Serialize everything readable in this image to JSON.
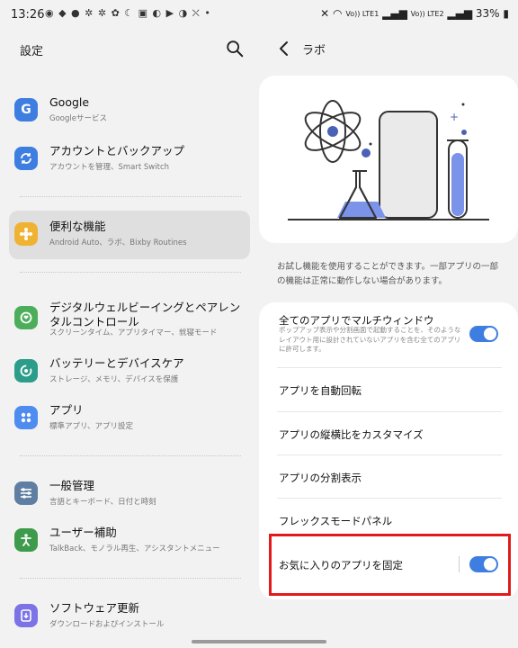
{
  "status_bar": {
    "time": "13:26",
    "notification_icons": "◉ ◆ ● ✲ ✲ ✿ ☾ ▣ ◐ ▶ ◑ ⛌ •",
    "network_label_1": "Vo)) LTE1",
    "network_label_2": "Vo)) LTE2",
    "battery": "33%"
  },
  "settings": {
    "title": "設定",
    "items": [
      {
        "title": "Google",
        "subtitle": "Googleサービス",
        "icon": "google-icon",
        "color": "#3d7ee0"
      },
      {
        "title": "アカウントとバックアップ",
        "subtitle": "アカウントを管理、Smart Switch",
        "icon": "sync-icon",
        "color": "#3d7ee0"
      },
      {
        "title": "便利な機能",
        "subtitle": "Android Auto、ラボ、Bixby Routines",
        "icon": "advanced-features-icon",
        "color": "#f0b233"
      },
      {
        "title": "デジタルウェルビーイングとペアレンタルコントロール",
        "subtitle": "スクリーンタイム、アプリタイマー、就寝モード",
        "icon": "wellbeing-icon",
        "color": "#4cae5a"
      },
      {
        "title": "バッテリーとデバイスケア",
        "subtitle": "ストレージ、メモリ、デバイスを保護",
        "icon": "device-care-icon",
        "color": "#2b9d8a"
      },
      {
        "title": "アプリ",
        "subtitle": "標準アプリ、アプリ設定",
        "icon": "apps-icon",
        "color": "#4e8cf0"
      },
      {
        "title": "一般管理",
        "subtitle": "言語とキーボード、日付と時刻",
        "icon": "general-management-icon",
        "color": "#5f7fa2"
      },
      {
        "title": "ユーザー補助",
        "subtitle": "TalkBack、モノラル再生、アシスタントメニュー",
        "icon": "accessibility-icon",
        "color": "#3e9b4c"
      },
      {
        "title": "ソフトウェア更新",
        "subtitle": "ダウンロードおよびインストール",
        "icon": "software-update-icon",
        "color": "#7b73e6"
      }
    ]
  },
  "labs": {
    "title": "ラボ",
    "description": "お試し機能を使用することができます。一部アプリの一部の機能は正常に動作しない場合があります。",
    "rows": [
      {
        "label": "全てのアプリでマルチウィンドウ",
        "subtitle": "ポップアップ表示や分割画面で起動することを、そのようなレイアウト用に設計されていないアプリを含む全てのアプリに許可します。",
        "toggle": true
      },
      {
        "label": "アプリを自動回転"
      },
      {
        "label": "アプリの縦横比をカスタマイズ"
      },
      {
        "label": "アプリの分割表示"
      },
      {
        "label": "フレックスモードパネル"
      },
      {
        "label": "お気に入りのアプリを固定",
        "toggle": true
      }
    ]
  },
  "colors": {
    "accent": "#3e7ee0",
    "highlight_box": "#e21a1a"
  }
}
